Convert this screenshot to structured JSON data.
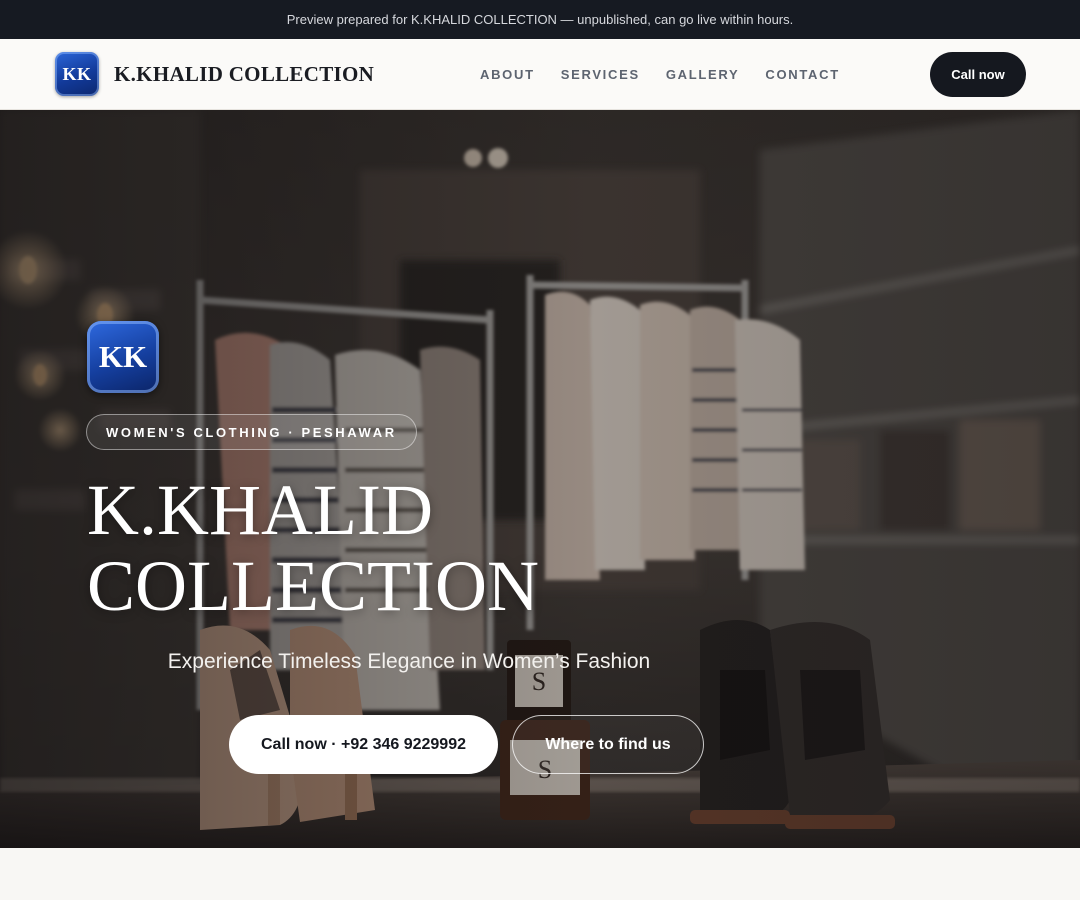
{
  "preview_banner": {
    "text": "Preview prepared for K.KHALID COLLECTION — unpublished, can go live within hours."
  },
  "header": {
    "logo_text": "KK",
    "brand_name": "K.KHALID COLLECTION",
    "nav": [
      {
        "label": "ABOUT"
      },
      {
        "label": "SERVICES"
      },
      {
        "label": "GALLERY"
      },
      {
        "label": "CONTACT"
      }
    ],
    "cta_label": "Call now"
  },
  "hero": {
    "logo_text": "KK",
    "eyebrow": "WOMEN'S CLOTHING · PESHAWAR",
    "title_line1": "K.KHALID",
    "title_line2": "COLLECTION",
    "subtitle": "Experience Timeless Elegance in Women’s Fashion",
    "primary_button": "Call now · +92 346 9229992",
    "secondary_button": "Where to find us"
  },
  "colors": {
    "brand_blue": "#1a4bb8",
    "dark": "#15181f",
    "banner_bg": "#161a22",
    "page_bg": "#f8f7f4"
  }
}
